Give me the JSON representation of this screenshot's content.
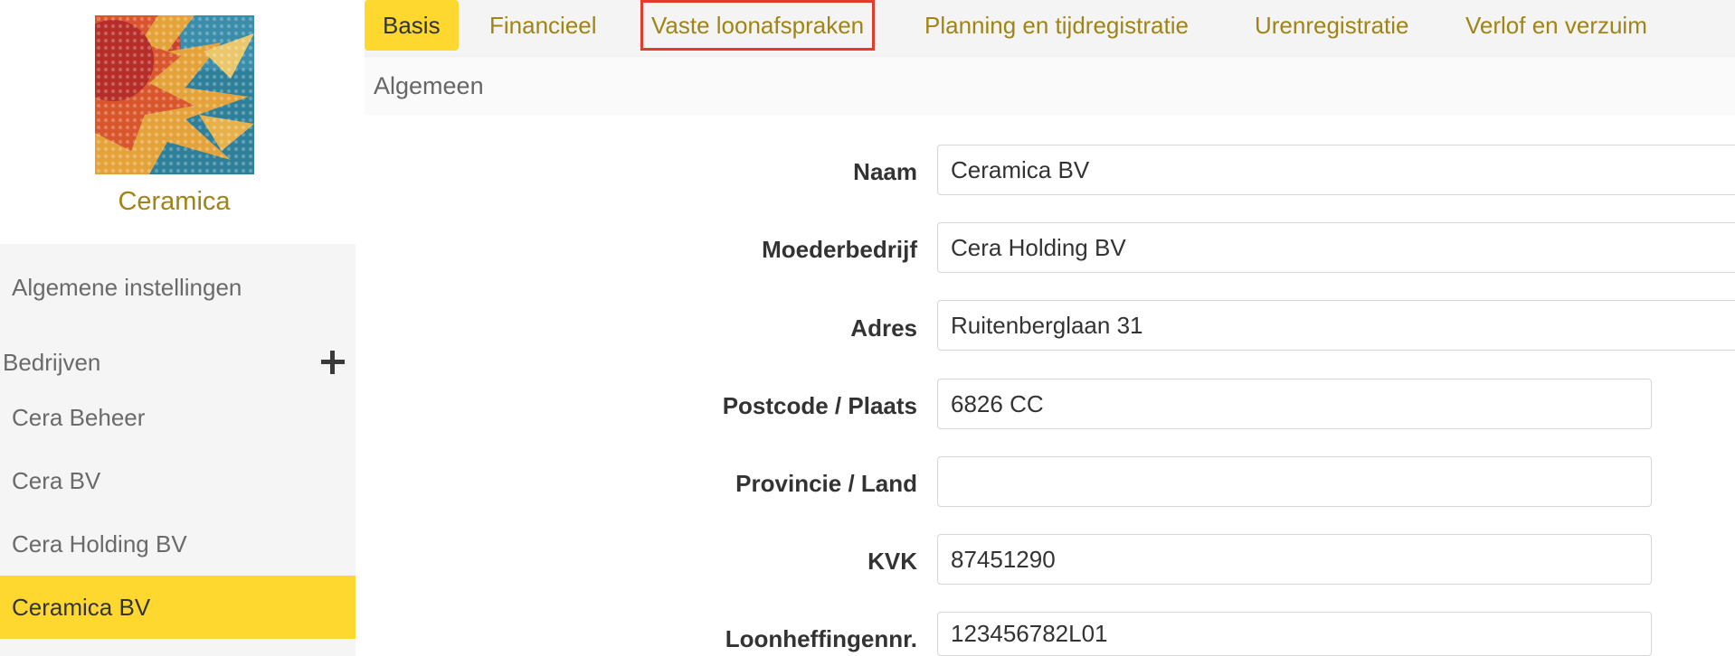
{
  "sidebar": {
    "company_title": "Ceramica",
    "general_settings": "Algemene instellingen",
    "companies_heading": "Bedrijven",
    "companies": [
      {
        "label": "Cera Beheer"
      },
      {
        "label": "Cera BV"
      },
      {
        "label": "Cera Holding BV"
      },
      {
        "label": "Ceramica BV",
        "active": true
      }
    ]
  },
  "tabs": [
    {
      "label": "Basis",
      "active": true
    },
    {
      "label": "Financieel"
    },
    {
      "label": "Vaste loonafspraken",
      "highlighted": true
    },
    {
      "label": "Planning en tijdregistratie"
    },
    {
      "label": "Urenregistratie"
    },
    {
      "label": "Verlof en verzuim"
    }
  ],
  "section_title": "Algemeen",
  "form": {
    "naam": {
      "label": "Naam",
      "value": "Ceramica BV"
    },
    "moederbedrijf": {
      "label": "Moederbedrijf",
      "value": "Cera Holding BV"
    },
    "adres": {
      "label": "Adres",
      "value": "Ruitenberglaan 31"
    },
    "postcode": {
      "label": "Postcode / Plaats",
      "value": "6826 CC"
    },
    "provincie": {
      "label": "Provincie / Land",
      "value": ""
    },
    "kvk": {
      "label": "KVK",
      "value": "87451290"
    },
    "loonheffing": {
      "label": "Loonheffingennr.",
      "value": "123456782L01"
    }
  },
  "colors": {
    "accent": "#fed82f",
    "link": "#a08416",
    "highlight_border": "#e43b2c"
  }
}
